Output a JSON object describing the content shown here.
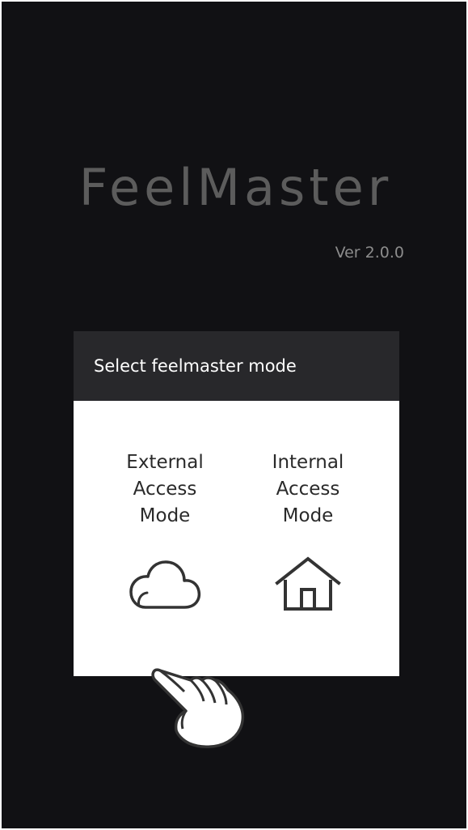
{
  "app": {
    "logo_text": "FeelMaster",
    "version": "Ver 2.0.0"
  },
  "dialog": {
    "title": "Select feelmaster mode",
    "options": [
      {
        "label_lines": [
          "External",
          "Access",
          "Mode"
        ],
        "icon": "cloud-icon"
      },
      {
        "label_lines": [
          "Internal",
          "Access",
          "Mode"
        ],
        "icon": "house-icon"
      }
    ]
  },
  "overlay": {
    "icon": "tap-hand-icon"
  },
  "colors": {
    "background": "#111114",
    "dialog_header": "#28282b",
    "dialog_body": "#ffffff",
    "logo": "#5c5c5c",
    "version": "#8c8c8c"
  }
}
